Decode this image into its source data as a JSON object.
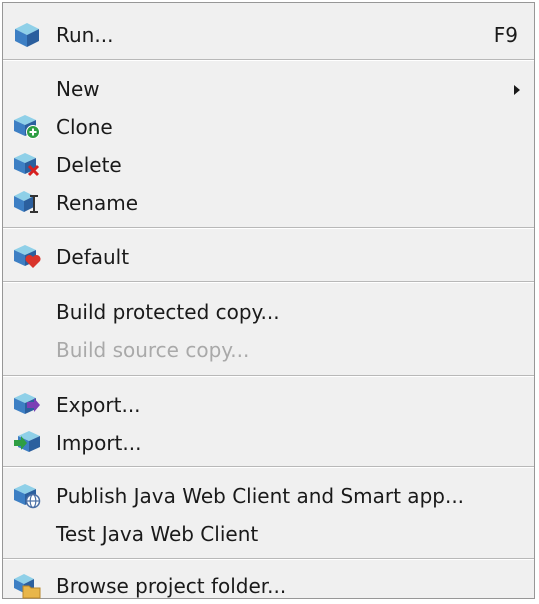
{
  "menu": {
    "run": {
      "label": "Run...",
      "shortcut": "F9",
      "icon": "run-icon"
    },
    "new": {
      "label": "New"
    },
    "clone": {
      "label": "Clone",
      "icon": "clone-icon"
    },
    "delete": {
      "label": "Delete",
      "icon": "delete-icon"
    },
    "rename": {
      "label": "Rename",
      "icon": "rename-icon"
    },
    "default": {
      "label": "Default",
      "icon": "default-icon"
    },
    "build_protected": {
      "label": "Build protected copy..."
    },
    "build_source": {
      "label": "Build source copy...",
      "disabled": true
    },
    "export": {
      "label": "Export...",
      "icon": "export-icon"
    },
    "import": {
      "label": "Import...",
      "icon": "import-icon"
    },
    "publish": {
      "label": "Publish Java Web Client and Smart app...",
      "icon": "publish-web-icon"
    },
    "test_web": {
      "label": "Test Java Web Client"
    },
    "browse": {
      "label": "Browse project folder...",
      "icon": "folder-icon"
    }
  },
  "colors": {
    "cube_blue": "#3d7fc4",
    "cube_teal": "#5bb3cf",
    "disabled_text": "#a9a9a9"
  }
}
